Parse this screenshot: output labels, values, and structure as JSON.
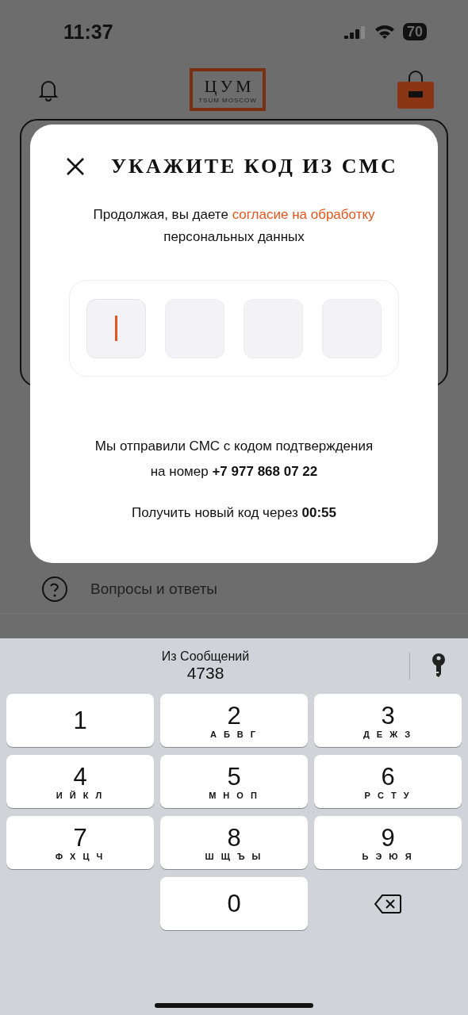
{
  "status_bar": {
    "time": "11:37",
    "battery": "70"
  },
  "header": {
    "logo": {
      "letters": [
        "Ц",
        "У",
        "М"
      ],
      "tagline": "TSUM MOSCOW"
    }
  },
  "menu": [
    {
      "label": "Вопросы и ответы"
    }
  ],
  "dialog": {
    "title": "УКАЖИТЕ КОД ИЗ СМС",
    "consent": {
      "text": "Продолжая, вы даете ",
      "link": "согласие на обработку",
      "text_after": "персональных данных"
    },
    "code_cells": [
      {
        "focused": true
      },
      {
        "focused": false
      },
      {
        "focused": false
      },
      {
        "focused": false
      }
    ],
    "sent_message": [
      "Мы отправили СМС с кодом подтверждения",
      "на номер **+7 977 868 07 22**"
    ],
    "resend": "Получить новый код через **00:55**"
  },
  "keyboard": {
    "suggestion": {
      "source": "Из Сообщений",
      "code": "4738"
    },
    "keys": [
      {
        "kind": "digit",
        "digit": "1"
      },
      {
        "kind": "digit",
        "digit": "2",
        "letters": "А Б В Г"
      },
      {
        "kind": "digit",
        "digit": "3",
        "letters": "Д Е Ж З"
      },
      {
        "kind": "digit",
        "digit": "4",
        "letters": "И Й К Л"
      },
      {
        "kind": "digit",
        "digit": "5",
        "letters": "М Н О П"
      },
      {
        "kind": "digit",
        "digit": "6",
        "letters": "Р С Т У"
      },
      {
        "kind": "digit",
        "digit": "7",
        "letters": "Ф Х Ц Ч"
      },
      {
        "kind": "digit",
        "digit": "8",
        "letters": "Ш Щ Ъ Ы"
      },
      {
        "kind": "digit",
        "digit": "9",
        "letters": "Ь Э Ю Я"
      },
      {
        "kind": "blank"
      },
      {
        "kind": "digit",
        "digit": "0"
      },
      {
        "kind": "backspace"
      }
    ]
  }
}
